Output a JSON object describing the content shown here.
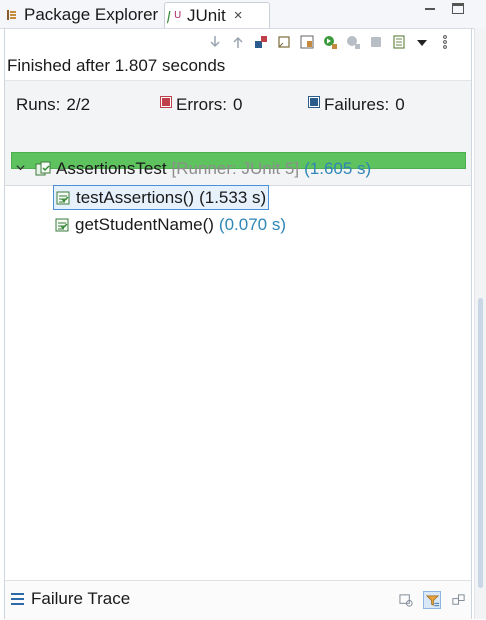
{
  "tabs": {
    "package_explorer": "Package Explorer",
    "junit": "JUnit",
    "close_glyph": "×"
  },
  "status": {
    "finished": "Finished after 1.807 seconds"
  },
  "counters": {
    "runs_label": "Runs:",
    "runs_value": "2/2",
    "errors_label": "Errors:",
    "errors_value": "0",
    "failures_label": "Failures:",
    "failures_value": "0"
  },
  "progress": {
    "fraction": 1.0,
    "color": "#5ec35e"
  },
  "tree": {
    "root": {
      "name": "AssertionsTest",
      "runner": "[Runner: JUnit 5]",
      "time": "(1.605 s)"
    },
    "children": [
      {
        "name": "testAssertions()",
        "time": "(1.533 s)",
        "selected": true
      },
      {
        "name": "getStudentName()",
        "time": "(0.070 s)",
        "selected": false
      }
    ]
  },
  "failure_trace": {
    "title": "Failure Trace"
  },
  "toolbar_icons": [
    "next-failure-icon",
    "previous-failure-icon",
    "show-failures-only-icon",
    "scroll-lock-icon",
    "layout-icon",
    "rerun-icon",
    "rerun-failed-first-icon",
    "stop-icon",
    "history-icon",
    "view-menu-icon",
    "more-icon"
  ],
  "colors": {
    "accent": "#2f86b7",
    "progress_green": "#5ec35e",
    "selection_border": "#4a90d9",
    "error_red": "#c0404a",
    "failure_blue": "#2b5b8a"
  }
}
